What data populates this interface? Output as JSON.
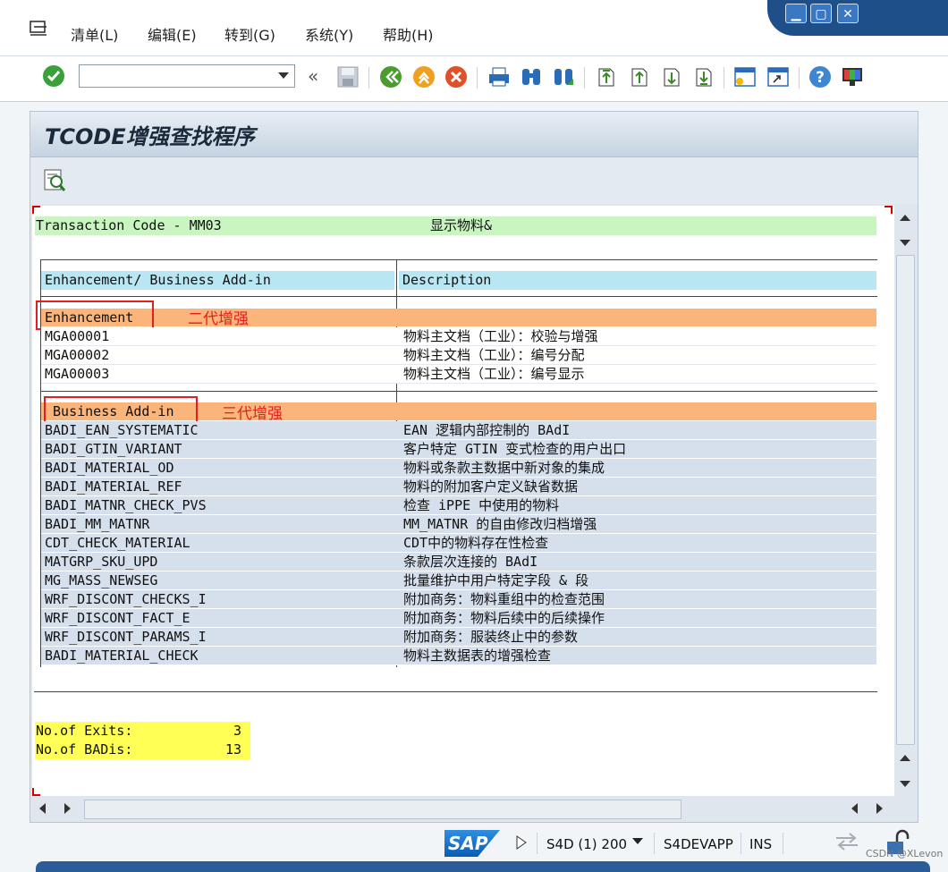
{
  "menu": {
    "items": [
      "清单(L)",
      "编辑(E)",
      "转到(G)",
      "系统(Y)",
      "帮助(H)"
    ]
  },
  "window_controls": {
    "minimize": "▁",
    "maximize": "▢",
    "close": "✕"
  },
  "toolbar": {
    "command_field_value": "",
    "back_double": "«"
  },
  "screen": {
    "title": "TCODE增强查找程序"
  },
  "list": {
    "transaction_label": "Transaction Code - MM03",
    "transaction_desc": "显示物料&",
    "col_headers": [
      "Enhancement/ Business Add-in",
      "Description"
    ],
    "enhancement_header": "Enhancement",
    "enhancement_annotation": "二代增强",
    "enhancements": [
      {
        "name": "MGA00001",
        "desc": "物料主文档（工业）：校验与增强"
      },
      {
        "name": "MGA00002",
        "desc": "物料主文档（工业）：编号分配"
      },
      {
        "name": "MGA00003",
        "desc": "物料主文档（工业）：编号显示"
      }
    ],
    "badi_header": " Business Add-in",
    "badi_annotation": "三代增强",
    "badis": [
      {
        "name": "BADI_EAN_SYSTEMATIC",
        "desc": "EAN 逻辑内部控制的 BAdI"
      },
      {
        "name": "BADI_GTIN_VARIANT",
        "desc": "客户特定 GTIN 变式检查的用户出口"
      },
      {
        "name": "BADI_MATERIAL_OD",
        "desc": "物料或条款主数据中新对象的集成"
      },
      {
        "name": "BADI_MATERIAL_REF",
        "desc": "物料的附加客户定义缺省数据"
      },
      {
        "name": "BADI_MATNR_CHECK_PVS",
        "desc": "检查 iPPE 中使用的物料"
      },
      {
        "name": "BADI_MM_MATNR",
        "desc": "MM_MATNR 的自由修改归档增强"
      },
      {
        "name": "CDT_CHECK_MATERIAL",
        "desc": "CDT中的物料存在性检查"
      },
      {
        "name": "MATGRP_SKU_UPD",
        "desc": "条款层次连接的 BAdI"
      },
      {
        "name": "MG_MASS_NEWSEG",
        "desc": "批量维护中用户特定字段 & 段"
      },
      {
        "name": "WRF_DISCONT_CHECKS_I",
        "desc": "附加商务：物料重组中的检查范围"
      },
      {
        "name": "WRF_DISCONT_FACT_E",
        "desc": "附加商务：物料后续中的后续操作"
      },
      {
        "name": "WRF_DISCONT_PARAMS_I",
        "desc": "附加商务：服装终止中的参数"
      },
      {
        "name": "BADI_MATERIAL_CHECK",
        "desc": "物料主数据表的增强检查"
      }
    ],
    "summary": [
      {
        "label": "No.of Exits:",
        "value": "3"
      },
      {
        "label": "No.of BADis:",
        "value": "13"
      }
    ]
  },
  "statusbar": {
    "logo": "SAP",
    "system": "S4D (1) 200",
    "server": "S4DEVAPP",
    "mode": "INS"
  },
  "watermark": "CSDN @XLevon",
  "colors": {
    "green_bar": "#c8f5c0",
    "header_cyan": "#b8e6f2",
    "orange": "#fbb47a",
    "row_blue": "#d6e0ec",
    "summary_yellow": "#ffff55",
    "annotation_red": "#e02020"
  },
  "icons": [
    "menu-icon",
    "check-icon",
    "back-icon",
    "save-icon",
    "back-green-icon",
    "exit-icon",
    "cancel-icon",
    "print-icon",
    "find-icon",
    "find-next-icon",
    "first-page-icon",
    "prev-page-icon",
    "next-page-icon",
    "last-page-icon",
    "new-session-icon",
    "shortcut-icon",
    "help-icon",
    "customize-icon",
    "detail-icon"
  ]
}
